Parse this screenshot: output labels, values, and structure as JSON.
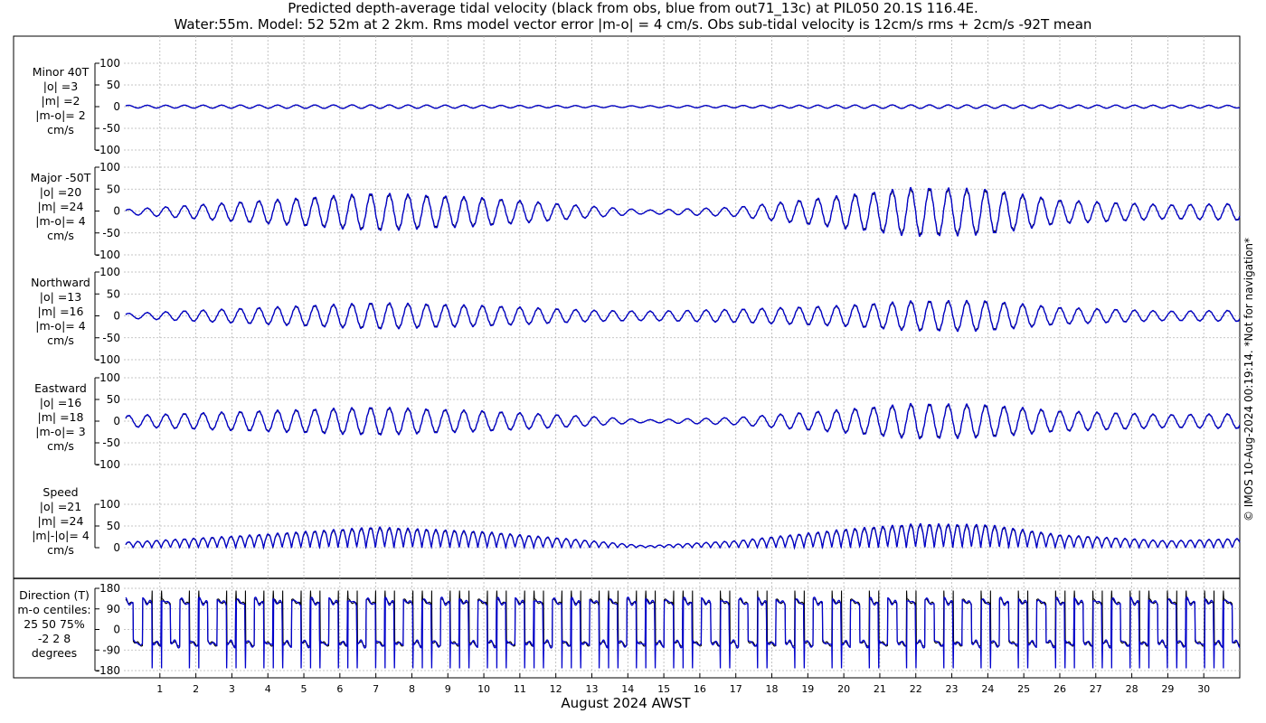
{
  "title": {
    "line1": "Predicted depth-average tidal velocity (black from obs, blue from out71_13c) at PIL050 20.1S 116.4E.",
    "line2": "Water:55m. Model: 52 52m at 2 2km. Rms model vector error |m-o| = 4 cm/s. Obs sub-tidal velocity is 12cm/s rms + 2cm/s -92T mean"
  },
  "copyright": "© IMOS 10-Aug-2024 00:19:14. *Not for navigation*",
  "colors": {
    "obs": "#000000",
    "model": "#0000cc",
    "grid": "#b4b4b4"
  },
  "chart_data": {
    "type": "line",
    "xlabel": "August 2024 AWST",
    "xlim": [
      0,
      31
    ],
    "xticks": [
      "1",
      "2",
      "3",
      "4",
      "5",
      "6",
      "7",
      "8",
      "9",
      "10",
      "11",
      "12",
      "13",
      "14",
      "15",
      "16",
      "17",
      "18",
      "19",
      "20",
      "21",
      "22",
      "23",
      "24",
      "25",
      "26",
      "27",
      "28",
      "29",
      "30"
    ],
    "series": [
      {
        "name": "obs",
        "color": "#000000"
      },
      {
        "name": "model",
        "color": "#0000cc"
      }
    ],
    "panels": [
      {
        "id": "minor",
        "labels": [
          "Minor 40T",
          "|o| =3",
          "|m| =2",
          "|m-o|= 2",
          "cm/s"
        ],
        "ylim": [
          -100,
          100
        ],
        "yticks": [
          "100",
          "50",
          "0",
          "-50",
          "-100"
        ],
        "yvals": [
          100,
          50,
          0,
          -50,
          -100
        ],
        "amplitude_by_day": [
          [
            0,
            3
          ],
          [
            7,
            4
          ],
          [
            14,
            2
          ],
          [
            22,
            4
          ],
          [
            31,
            3
          ]
        ],
        "offset": 0
      },
      {
        "id": "major",
        "labels": [
          "Major -50T",
          "|o| =20",
          "|m| =24",
          "|m-o|= 4",
          "cm/s"
        ],
        "ylim": [
          -100,
          100
        ],
        "yticks": [
          "100",
          "50",
          "0",
          "-50",
          "-100"
        ],
        "yvals": [
          100,
          50,
          0,
          -50,
          -100
        ],
        "amplitude_by_day": [
          [
            0,
            5
          ],
          [
            3,
            20
          ],
          [
            7,
            40
          ],
          [
            10,
            30
          ],
          [
            13,
            12
          ],
          [
            14.5,
            4
          ],
          [
            17,
            10
          ],
          [
            20,
            35
          ],
          [
            22,
            52
          ],
          [
            24,
            48
          ],
          [
            26,
            25
          ],
          [
            29,
            15
          ],
          [
            31,
            18
          ]
        ],
        "offset": -2
      },
      {
        "id": "northward",
        "labels": [
          "Northward",
          "|o| =13",
          "|m| =16",
          "|m-o|= 4",
          "cm/s"
        ],
        "ylim": [
          -100,
          100
        ],
        "yticks": [
          "100",
          "50",
          "0",
          "-50",
          "-100"
        ],
        "yvals": [
          100,
          50,
          0,
          -50,
          -100
        ],
        "amplitude_by_day": [
          [
            0,
            5
          ],
          [
            3,
            15
          ],
          [
            7,
            28
          ],
          [
            10,
            22
          ],
          [
            13,
            12
          ],
          [
            14.5,
            10
          ],
          [
            17,
            14
          ],
          [
            20,
            22
          ],
          [
            22,
            32
          ],
          [
            24,
            32
          ],
          [
            26,
            18
          ],
          [
            29,
            10
          ],
          [
            31,
            12
          ]
        ],
        "offset": 0
      },
      {
        "id": "eastward",
        "labels": [
          "Eastward",
          "|o| =16",
          "|m| =18",
          "|m-o|= 3",
          "cm/s"
        ],
        "ylim": [
          -100,
          100
        ],
        "yticks": [
          "100",
          "50",
          "0",
          "-50",
          "-100"
        ],
        "yvals": [
          100,
          50,
          0,
          -50,
          -100
        ],
        "amplitude_by_day": [
          [
            0,
            12
          ],
          [
            3,
            20
          ],
          [
            7,
            30
          ],
          [
            10,
            22
          ],
          [
            13,
            10
          ],
          [
            14.5,
            3
          ],
          [
            17,
            8
          ],
          [
            20,
            25
          ],
          [
            22,
            38
          ],
          [
            24,
            35
          ],
          [
            26,
            22
          ],
          [
            29,
            14
          ],
          [
            31,
            16
          ]
        ],
        "offset": 0
      },
      {
        "id": "speed",
        "labels": [
          "Speed",
          "|o| =21",
          "|m| =24",
          "|m|-|o|= 4",
          "cm/s"
        ],
        "ylim": [
          0,
          100
        ],
        "yticks": [
          "100",
          "50",
          "0"
        ],
        "yvals": [
          100,
          50,
          0
        ],
        "amplitude_by_day": [
          [
            0,
            12
          ],
          [
            3,
            25
          ],
          [
            7,
            45
          ],
          [
            10,
            35
          ],
          [
            13,
            15
          ],
          [
            14.5,
            4
          ],
          [
            17,
            15
          ],
          [
            20,
            40
          ],
          [
            22,
            52
          ],
          [
            24,
            50
          ],
          [
            26,
            28
          ],
          [
            29,
            15
          ],
          [
            31,
            20
          ]
        ],
        "offset": 0
      },
      {
        "id": "direction",
        "labels": [
          "Direction (T)",
          "m-o centiles:",
          "25  50  75%",
          "-2  2  8",
          "degrees"
        ],
        "ylim": [
          -180,
          180
        ],
        "yticks": [
          "180",
          "90",
          "0",
          "-90",
          "-180"
        ],
        "yvals": [
          180,
          90,
          0,
          -90,
          -180
        ],
        "high_deg": 130,
        "low_deg": -50,
        "min_deg": -180,
        "max_deg": 180
      }
    ],
    "tide_period_hours": 12.42
  }
}
